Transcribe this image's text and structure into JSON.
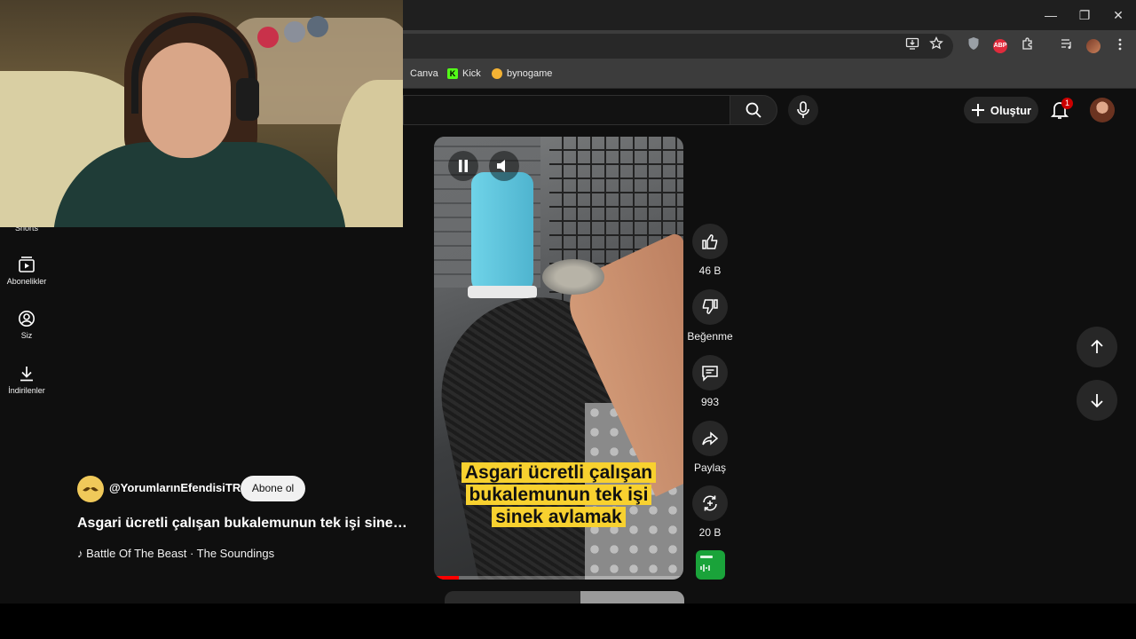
{
  "window": {
    "minimize": "—",
    "restore": "❐",
    "close": "✕"
  },
  "bookmarks": [
    {
      "label": "Canva",
      "icon": "canva-icon"
    },
    {
      "label": "Kick",
      "icon": "kick-icon",
      "badge": "K",
      "color": "#53fc18"
    },
    {
      "label": "bynogame",
      "icon": "bynogame-icon"
    }
  ],
  "extensions": {
    "abp": "ABP"
  },
  "header": {
    "create_label": "Oluştur",
    "notification_count": "1"
  },
  "sidebar": {
    "items": [
      {
        "label": "Shorts",
        "icon": "shorts-icon"
      },
      {
        "label": "Abonelikler",
        "icon": "subscriptions-icon"
      },
      {
        "label": "Siz",
        "icon": "you-icon"
      },
      {
        "label": "İndirilenler",
        "icon": "downloads-icon"
      }
    ]
  },
  "video": {
    "caption": "Asgari ücretli çalışan bukalemunun tek işi sinek avlamak",
    "progress": 0.1
  },
  "actions": {
    "likes": "46 B",
    "dislike_label": "Beğenme",
    "comments": "993",
    "share_label": "Paylaş",
    "remix_count": "20 B"
  },
  "channel": {
    "handle": "@YorumlarınEfendisiTR",
    "subscribe_label": "Abone ol"
  },
  "title": "Asgari ücretli çalışan bukalemunun tek işi sinek avlamak",
  "music": {
    "note": "♪",
    "track": "Battle Of The Beast · The Soundings"
  },
  "colors": {
    "page_bg": "#0f0f0f",
    "chrome_bg": "#3c3c3c",
    "caption_bg": "#f8d12f",
    "progress": "#ff0000",
    "notification": "#cc0000"
  }
}
